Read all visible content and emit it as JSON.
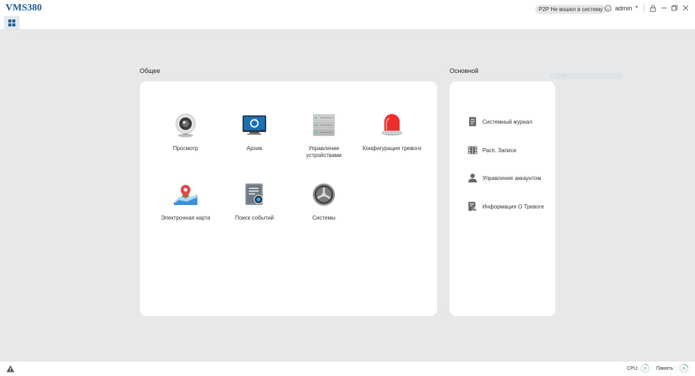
{
  "app": {
    "title": "VMS380"
  },
  "header": {
    "p2p_status": "P2P Не вошел в систему",
    "username": "admin",
    "icons": [
      "user-circle-icon",
      "chevron-down-icon",
      "lock-icon",
      "minimize-icon",
      "restore-icon",
      "close-icon"
    ]
  },
  "tabs": [
    {
      "icon": "grid-icon"
    }
  ],
  "general": {
    "title": "Общее",
    "tiles": [
      {
        "label": "Просмотр",
        "icon": "webcam-icon"
      },
      {
        "label": "Архив",
        "icon": "monitor-playback-icon"
      },
      {
        "label": "Управление устройствами",
        "icon": "server-stack-icon"
      },
      {
        "label": "Конфигурация тревоги",
        "icon": "alarm-siren-icon"
      },
      {
        "label": "Электронная карта",
        "icon": "map-pin-icon"
      },
      {
        "label": "Поиск событий",
        "icon": "document-search-icon"
      },
      {
        "label": "Системы",
        "icon": "gear-icon"
      }
    ]
  },
  "main_section": {
    "title": "Основной",
    "items": [
      {
        "label": "Системный журнал",
        "icon": "log-document-icon"
      },
      {
        "label": "Расп. Записи",
        "icon": "film-schedule-icon"
      },
      {
        "label": "Управление аккаунтом",
        "icon": "person-icon"
      },
      {
        "label": "Информация О Тревоге",
        "icon": "alarm-info-icon"
      }
    ]
  },
  "ghost_text": "Сис...",
  "status": {
    "cpu_label": "CPU:",
    "cpu_value": 10,
    "memory_label": "Память:",
    "memory_value": 20
  },
  "colors": {
    "accent": "#1c5a96",
    "gauge": "#3cb371"
  }
}
